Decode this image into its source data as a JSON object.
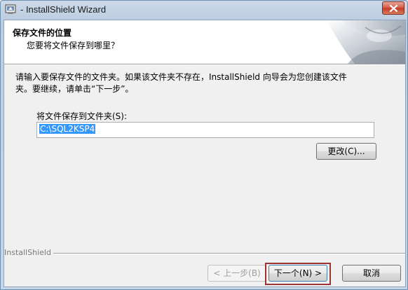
{
  "window": {
    "title": "- InstallShield Wizard"
  },
  "header": {
    "title": "保存文件的位置",
    "subtitle": "您要将文件保存到哪里？"
  },
  "body": {
    "intro_line1": "请输入要保存文件的文件夹。如果该文件夹不存在，InstallShield 向导会为您创建该文件",
    "intro_line2": "夹。要继续，请单击“下一步”。",
    "folder_label": "将文件保存到文件夹(S):",
    "folder_value": "C:\\SQL2KSP4",
    "change_button": "更改(C)..."
  },
  "footer": {
    "brand": "InstallShield",
    "back_button": "< 上一步(B)",
    "next_button": "下一个(N) >",
    "cancel_button": "取消"
  },
  "icons": [
    "installshield-app-icon",
    "close-icon"
  ],
  "colors": {
    "title_bar": "#c6d6e8",
    "selection": "#3399ff",
    "highlight_box": "#9b3535",
    "close_button": "#d4553e"
  }
}
